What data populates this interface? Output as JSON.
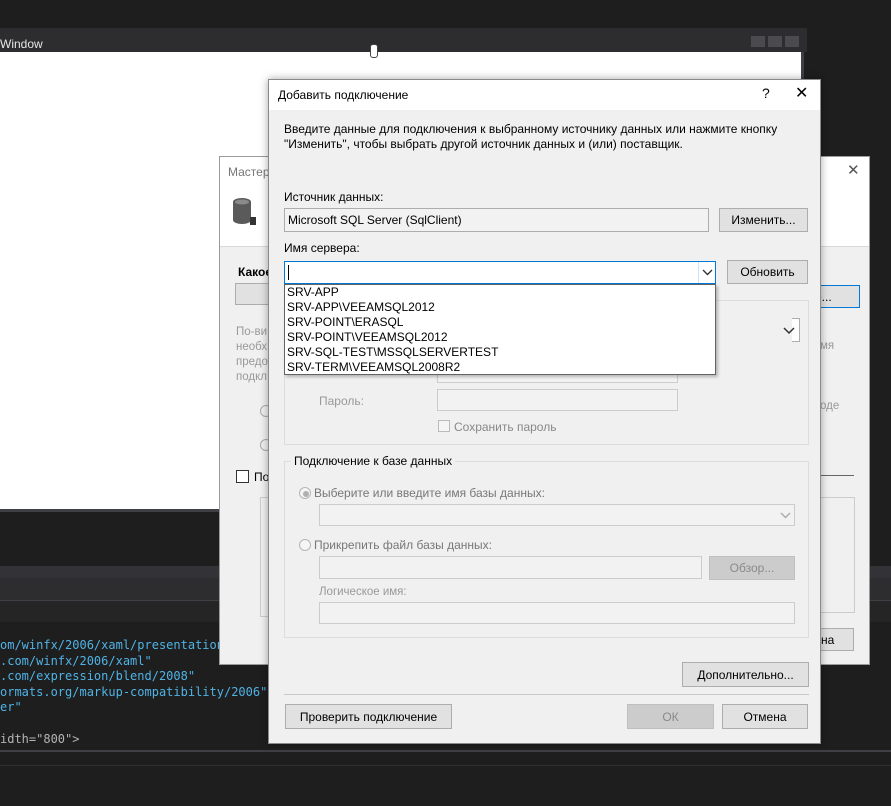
{
  "ide": {
    "window_title": "Window",
    "code_lines": [
      "om/winfx/2006/xaml/presentation\"",
      ".com/winfx/2006/xaml\"",
      ".com/expression/blend/2008\"",
      "ormats.org/markup-compatibility/2006\"",
      "er\"",
      "",
      "idth=\"800\">"
    ]
  },
  "wizard": {
    "title": "Мастер",
    "question": "Какое",
    "new_connection_partial": "е...",
    "left_text": "По-ви\nнеобх\nпредо\nподкл",
    "right_text": "мя\n\n\n\nоде",
    "checkbox_label": "По",
    "bottom_btn_partial": "на"
  },
  "dialog": {
    "title": "Добавить подключение",
    "help": "?",
    "close": "✕",
    "description": "Введите данные для подключения к выбранному источнику данных или нажмите кнопку \"Изменить\", чтобы выбрать другой источник данных и (или) поставщик.",
    "data_source_label": "Источник данных:",
    "data_source_value": "Microsoft SQL Server (SqlClient)",
    "change_button": "Изменить...",
    "server_name_label": "Имя сервера:",
    "server_name_value": "",
    "refresh_button": "Обновить",
    "server_list": [
      "SRV-APP",
      "SRV-APP\\VEEAMSQL2012",
      "SRV-POINT\\ERASQL",
      "SRV-POINT\\VEEAMSQL2012",
      "SRV-SQL-TEST\\MSSQLSERVERTEST",
      "SRV-TERM\\VEEAMSQL2008R2"
    ],
    "password_label": "Пароль:",
    "save_password_label": "Сохранить пароль",
    "db_group_label": "Подключение к базе данных",
    "db_select_label": "Выберите или введите имя базы данных:",
    "db_attach_label": "Прикрепить файл базы данных:",
    "browse_button": "Обзор...",
    "logical_name_label": "Логическое имя:",
    "advanced_button": "Дополнительно...",
    "test_button": "Проверить подключение",
    "ok_button": "ОК",
    "cancel_button": "Отмена"
  }
}
